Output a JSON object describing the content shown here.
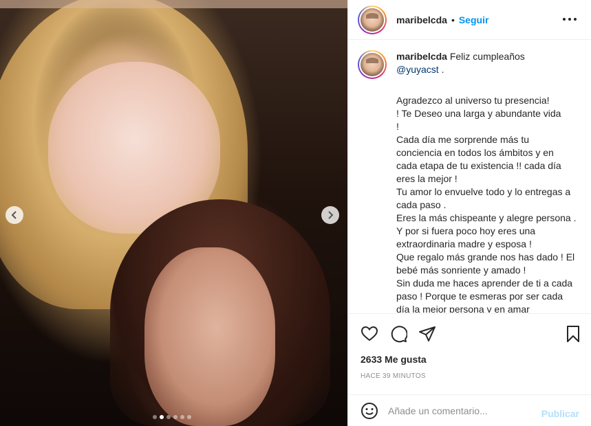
{
  "post": {
    "username": "maribelcda",
    "separator": "•",
    "follow_label": "Seguir",
    "more_icon": "more-options-icon"
  },
  "caption": {
    "username": "maribelcda",
    "intro": "Feliz cumpleaños",
    "mention": "@yuyacst",
    "mention_suffix": " .",
    "body": "Agradezco al universo tu presencia!\n! Te Deseo una larga y abundante vida\n!\nCada día me sorprende más tu conciencia en todos los ámbitos y en cada etapa de tu existencia !! cada día eres la mejor !\nTu amor lo envuelve todo y lo entregas a cada paso .\nEres la más chispeante y alegre persona . Y por si fuera poco hoy eres una extraordinaria madre y esposa !\nQue regalo más grande nos has dado ! El bebé más sonriente y amado !\nSin duda me haces aprender de ti a cada paso ! Porque te esmeras por ser cada día la mejor persona y en amar"
  },
  "carousel": {
    "slide_count": 6,
    "active_index": 1
  },
  "actions": {
    "likes_text": "2633 Me gusta",
    "time_text": "HACE 39 MINUTOS"
  },
  "comment": {
    "placeholder": "Añade un comentario...",
    "publish_label": "Publicar"
  },
  "colors": {
    "link": "#0095f6",
    "publish_disabled": "#b2dffc",
    "muted": "#8e8e8e"
  }
}
